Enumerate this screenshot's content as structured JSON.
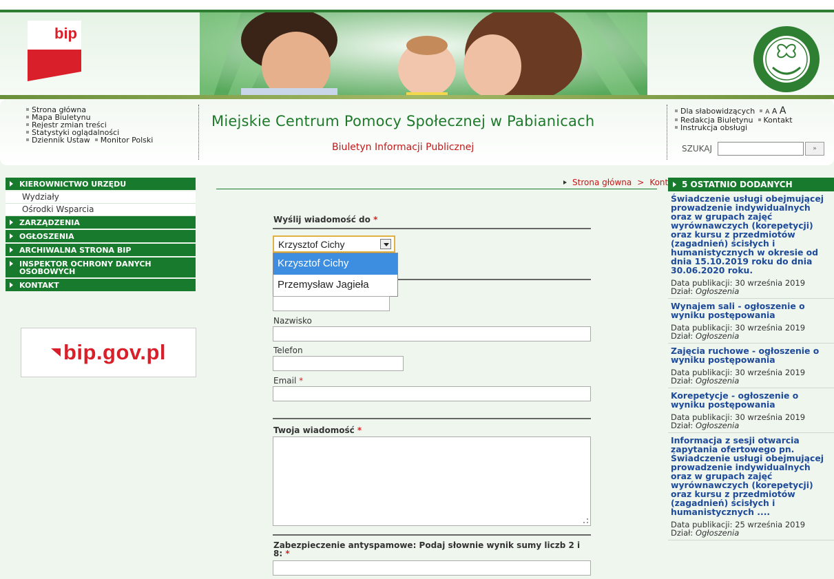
{
  "header": {
    "bip_logo_text": "bip",
    "seal_label": "Miejskie Centrum Pomocy Społecznej Pabianice"
  },
  "nav": {
    "left_links": [
      "Strona główna",
      "Mapa Biuletynu",
      "Rejestr zmian treści",
      "Statystyki oglądalności",
      "Dziennik Ustaw",
      "Monitor Polski"
    ],
    "title": "Miejskie Centrum Pomocy Społecznej w Pabianicach",
    "subtitle": "Biuletyn Informacji Publicznej",
    "right_links": {
      "low_vision": "Dla słabowidzących",
      "font_a1": "A",
      "font_a2": "A",
      "font_a3": "A",
      "editorial": "Redakcja Biuletynu",
      "contact": "Kontakt",
      "manual": "Instrukcja obsługi"
    },
    "search": {
      "label": "SZUKAJ",
      "button": "»",
      "value": ""
    }
  },
  "left_menu": [
    {
      "label": "KIEROWNICTWO URZĘDU",
      "type": "header"
    },
    {
      "label": "Wydziały",
      "type": "sub"
    },
    {
      "label": "Ośrodki Wsparcia",
      "type": "sub"
    },
    {
      "label": "ZARZĄDZENIA",
      "type": "header"
    },
    {
      "label": "OGŁOSZENIA",
      "type": "header"
    },
    {
      "label": "ARCHIWALNA STRONA BIP",
      "type": "header"
    },
    {
      "label": "INSPEKTOR OCHRONY DANYCH OSOBOWYCH",
      "type": "header"
    },
    {
      "label": "KONTAKT",
      "type": "header"
    }
  ],
  "bip_banner": "bip.gov.pl",
  "breadcrumb": {
    "home": "Strona główna",
    "sep": ">",
    "current": "Kontakt"
  },
  "form": {
    "send_to_label": "Wyślij wiadomość do",
    "required_mark": "*",
    "select": {
      "value": "Krzysztof Cichy",
      "options": [
        "Krzysztof Cichy",
        "Przemysław Jagieła"
      ],
      "highlighted": 0
    },
    "surname_label": "Nazwisko",
    "phone_label": "Telefon",
    "email_label": "Email",
    "message_label": "Twoja wiadomość",
    "antispam_label": "Zabezpieczenie antyspamowe: Podaj słownie wynik sumy liczb 2 i 8:"
  },
  "right_col": {
    "title": "5 OSTATNIO DODANYCH",
    "items": [
      {
        "title": "Świadczenie usługi obejmującej prowadzenie indywidualnych oraz w grupach zajęć wyrównawczych (korepetycji) oraz kursu z przedmiotów (zagadnień) ścisłych i humanistycznych w okresie od dnia 15.10.2019 roku do dnia 30.06.2020 roku.",
        "date": "Data publikacji: 30 września 2019",
        "dept_label": "Dział:",
        "dept": "Ogłoszenia"
      },
      {
        "title": "Wynajem sali - ogłoszenie o wyniku postępowania",
        "date": "Data publikacji: 30 września 2019",
        "dept_label": "Dział:",
        "dept": "Ogłoszenia"
      },
      {
        "title": "Zajęcia ruchowe - ogłoszenie o wyniku postępowania",
        "date": "Data publikacji: 30 września 2019",
        "dept_label": "Dział:",
        "dept": "Ogłoszenia"
      },
      {
        "title": "Korepetycje - ogłoszenie o wyniku postępowania",
        "date": "Data publikacji: 30 września 2019",
        "dept_label": "Dział:",
        "dept": "Ogłoszenia"
      },
      {
        "title": "Informacja z sesji otwarcia zapytania ofertowego pn. Świadczenie usługi obejmującej prowadzenie indywidualnych oraz w grupach zajęć wyrównawczych (korepetycji) oraz kursu z przedmiotów (zagadnień) ścisłych i humanistycznych ....",
        "date": "Data publikacji: 25 września 2019",
        "dept_label": "Dział:",
        "dept": "Ogłoszenia"
      }
    ]
  },
  "colors": {
    "green": "#187a2c",
    "red": "#d81f2a",
    "link_blue": "#1e4a9a",
    "dropdown_highlight": "#3d8ee0"
  }
}
